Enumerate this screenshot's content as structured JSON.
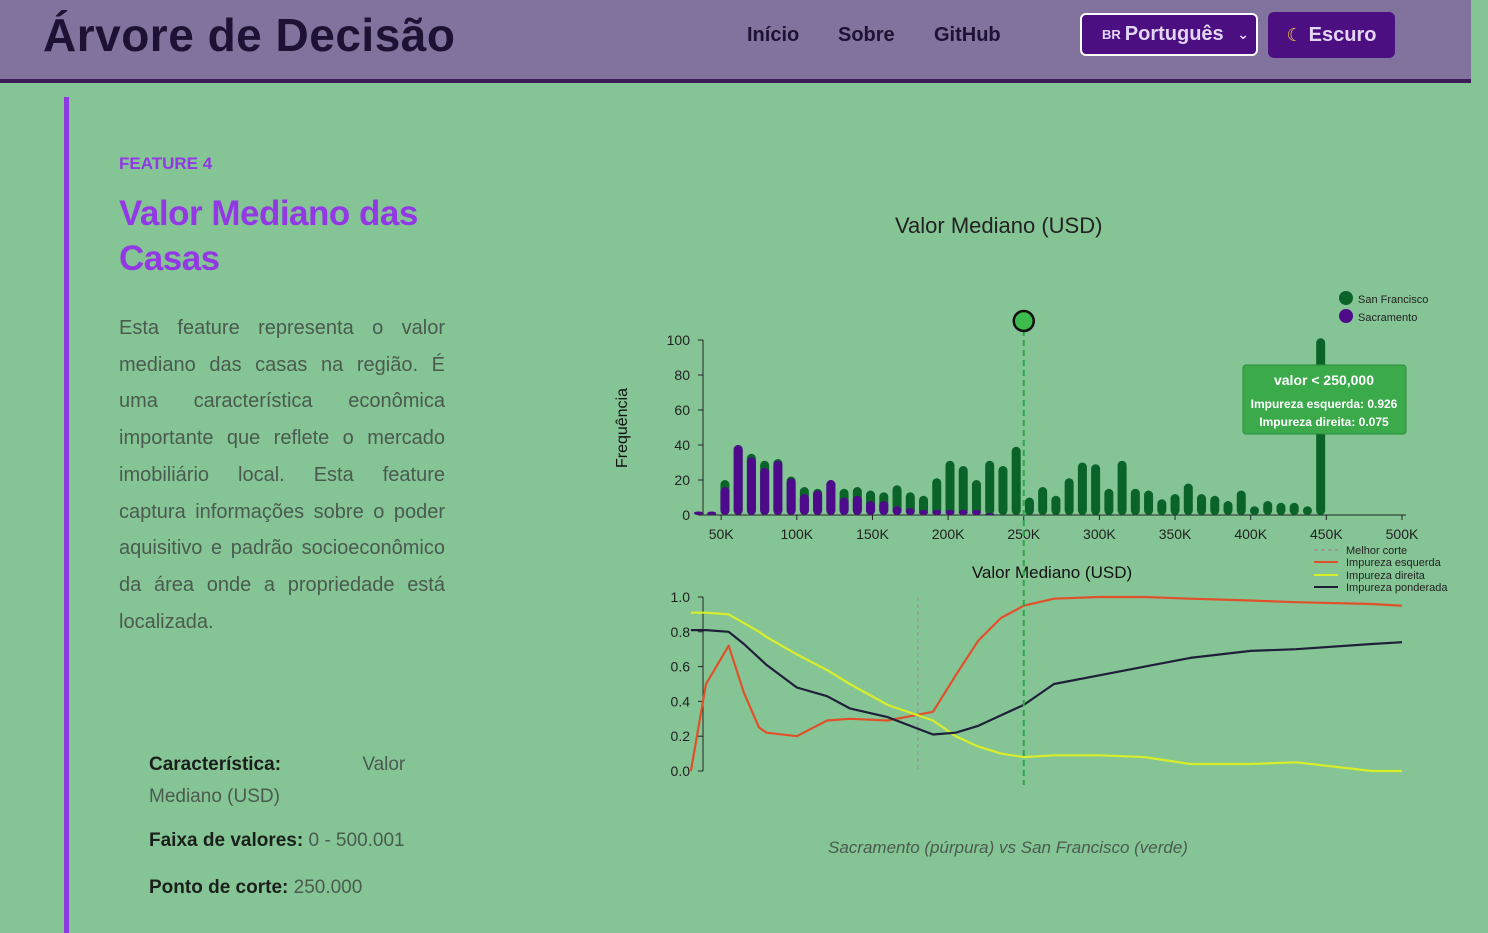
{
  "header": {
    "logo": "Árvore de Decisão",
    "nav": [
      "Início",
      "Sobre",
      "GitHub"
    ],
    "language": {
      "flag": "BR",
      "label": "Português"
    },
    "theme_label": "Escuro"
  },
  "section": {
    "kicker": "FEATURE 4",
    "title": "Valor Mediano das Casas",
    "description": "Esta feature representa o valor mediano das casas na região. É uma característica econômica importante que reflete o mercado imobiliário local. Esta feature captura informações sobre o poder aquisitivo e padrão socioeconômico da área onde a propriedade está localizada.",
    "info": [
      {
        "label": "Característica:",
        "value": "Valor Mediano (USD)"
      },
      {
        "label": "Faixa de valores:",
        "value": "0 - 500.001"
      },
      {
        "label": "Ponto de corte:",
        "value": "250.000"
      }
    ],
    "caption": "Sacramento (púrpura) vs San Francisco (verde)"
  },
  "tooltip": {
    "title": "valor < 250,000",
    "left": "Impureza esquerda: 0.926",
    "right": "Impureza direita: 0.075"
  },
  "chart_data": [
    {
      "type": "bar",
      "title": "Valor Mediano (USD)",
      "xlabel": "Valor Mediano (USD)",
      "ylabel": "Frequência",
      "xlim": [
        30000,
        510000
      ],
      "ylim": [
        0,
        100
      ],
      "x_ticks": [
        "50K",
        "100K",
        "150K",
        "200K",
        "250K",
        "300K",
        "350K",
        "400K",
        "450K",
        "500K"
      ],
      "x_tick_values": [
        50000,
        100000,
        150000,
        200000,
        250000,
        300000,
        350000,
        400000,
        450000,
        500000
      ],
      "y_ticks": [
        0,
        20,
        40,
        60,
        80,
        100
      ],
      "split_value": 250000,
      "legend": {
        "position": "top-right",
        "entries": [
          "San Francisco",
          "Sacramento"
        ]
      },
      "colors": {
        "San Francisco": "#0a6328",
        "Sacramento": "#4d0a8a",
        "split": "#2aa84a"
      },
      "bins": [
        35000,
        43750,
        52500,
        61250,
        70000,
        78750,
        87500,
        96250,
        105000,
        113750,
        122500,
        131250,
        140000,
        148750,
        157500,
        166250,
        175000,
        183750,
        192500,
        201250,
        210000,
        218750,
        227500,
        236250,
        245000,
        253750,
        262500,
        271250,
        280000,
        288750,
        297500,
        306250,
        315000,
        323750,
        332500,
        341250,
        350000,
        358750,
        367500,
        376250,
        385000,
        393750,
        402500,
        411250,
        420000,
        428750,
        437500,
        446250,
        455000,
        463750,
        472500,
        481250,
        490000,
        500000
      ],
      "series": [
        {
          "name": "San Francisco",
          "values": [
            2,
            1,
            20,
            40,
            35,
            31,
            32,
            22,
            16,
            15,
            20,
            15,
            16,
            14,
            13,
            17,
            13,
            11,
            21,
            31,
            28,
            20,
            31,
            28,
            39,
            10,
            16,
            11,
            21,
            30,
            29,
            15,
            31,
            15,
            14,
            9,
            12,
            18,
            12,
            11,
            8,
            14,
            5,
            8,
            7,
            7,
            5,
            101,
            0,
            0,
            0,
            0,
            0,
            0
          ]
        },
        {
          "name": "Sacramento",
          "values": [
            2,
            2,
            16,
            40,
            33,
            27,
            31,
            21,
            12,
            14,
            20,
            10,
            11,
            8,
            8,
            5,
            4,
            3,
            3,
            3,
            3,
            3,
            1,
            0,
            0,
            0,
            0,
            0,
            0,
            0,
            0,
            0,
            0,
            0,
            0,
            0,
            0,
            0,
            0,
            0,
            0,
            0,
            0,
            0,
            0,
            0,
            0,
            0,
            0,
            0,
            0,
            0,
            0,
            0
          ]
        }
      ]
    },
    {
      "type": "line",
      "x": [
        30000,
        40000,
        55000,
        65000,
        75000,
        80000,
        100000,
        120000,
        135000,
        160000,
        190000,
        205000,
        220000,
        235000,
        250000,
        270000,
        300000,
        330000,
        360000,
        400000,
        430000,
        480000,
        500000
      ],
      "ylim": [
        0,
        1
      ],
      "y_ticks": [
        "0.0",
        "0.2",
        "0.4",
        "0.6",
        "0.8",
        "1.0"
      ],
      "legend": {
        "position": "top-right",
        "entries": [
          "Melhor corte",
          "Impureza esquerda",
          "Impureza direita",
          "Impureza ponderada"
        ]
      },
      "best_split": 180000,
      "colors": {
        "Melhor corte": "#999999",
        "Impureza esquerda": "#e0502a",
        "Impureza direita": "#d8ee2a",
        "Impureza ponderada": "#1f1f3a"
      },
      "series": [
        {
          "name": "Impureza esquerda",
          "values": [
            0.0,
            0.5,
            0.72,
            0.45,
            0.25,
            0.22,
            0.2,
            0.29,
            0.3,
            0.29,
            0.34,
            0.55,
            0.75,
            0.88,
            0.95,
            0.99,
            1.0,
            1.0,
            0.99,
            0.98,
            0.97,
            0.96,
            0.95
          ]
        },
        {
          "name": "Impureza direita",
          "values": [
            0.91,
            0.91,
            0.9,
            0.85,
            0.8,
            0.77,
            0.67,
            0.58,
            0.5,
            0.38,
            0.29,
            0.2,
            0.14,
            0.1,
            0.08,
            0.09,
            0.09,
            0.08,
            0.04,
            0.04,
            0.05,
            0.0,
            0.0
          ]
        },
        {
          "name": "Impureza ponderada",
          "values": [
            0.81,
            0.81,
            0.8,
            0.73,
            0.65,
            0.61,
            0.48,
            0.43,
            0.36,
            0.31,
            0.21,
            0.22,
            0.26,
            0.32,
            0.38,
            0.5,
            0.55,
            0.6,
            0.65,
            0.69,
            0.7,
            0.73,
            0.74
          ]
        }
      ]
    }
  ]
}
